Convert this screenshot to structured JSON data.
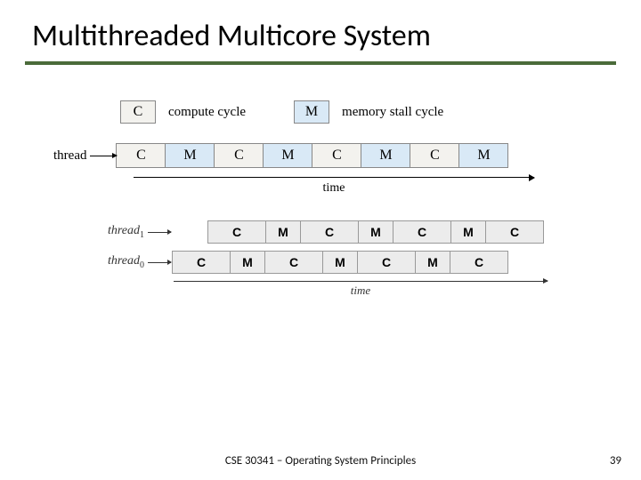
{
  "title": "Multithreaded Multicore System",
  "legend": {
    "c_letter": "C",
    "c_label": "compute cycle",
    "m_letter": "M",
    "m_label": "memory stall cycle"
  },
  "fig1": {
    "thread_label": "thread",
    "cells": [
      "C",
      "M",
      "C",
      "M",
      "C",
      "M",
      "C",
      "M"
    ],
    "time_label": "time"
  },
  "fig2": {
    "thread1_label": "thread",
    "thread1_sub": "1",
    "thread0_label": "thread",
    "thread0_sub": "0",
    "t1_cells": [
      "C",
      "M",
      "C",
      "M",
      "C",
      "M",
      "C"
    ],
    "t0_cells": [
      "C",
      "M",
      "C",
      "M",
      "C",
      "M",
      "C"
    ],
    "time_label": "time"
  },
  "footer": {
    "course": "CSE 30341 – Operating System Principles",
    "page": "39"
  }
}
